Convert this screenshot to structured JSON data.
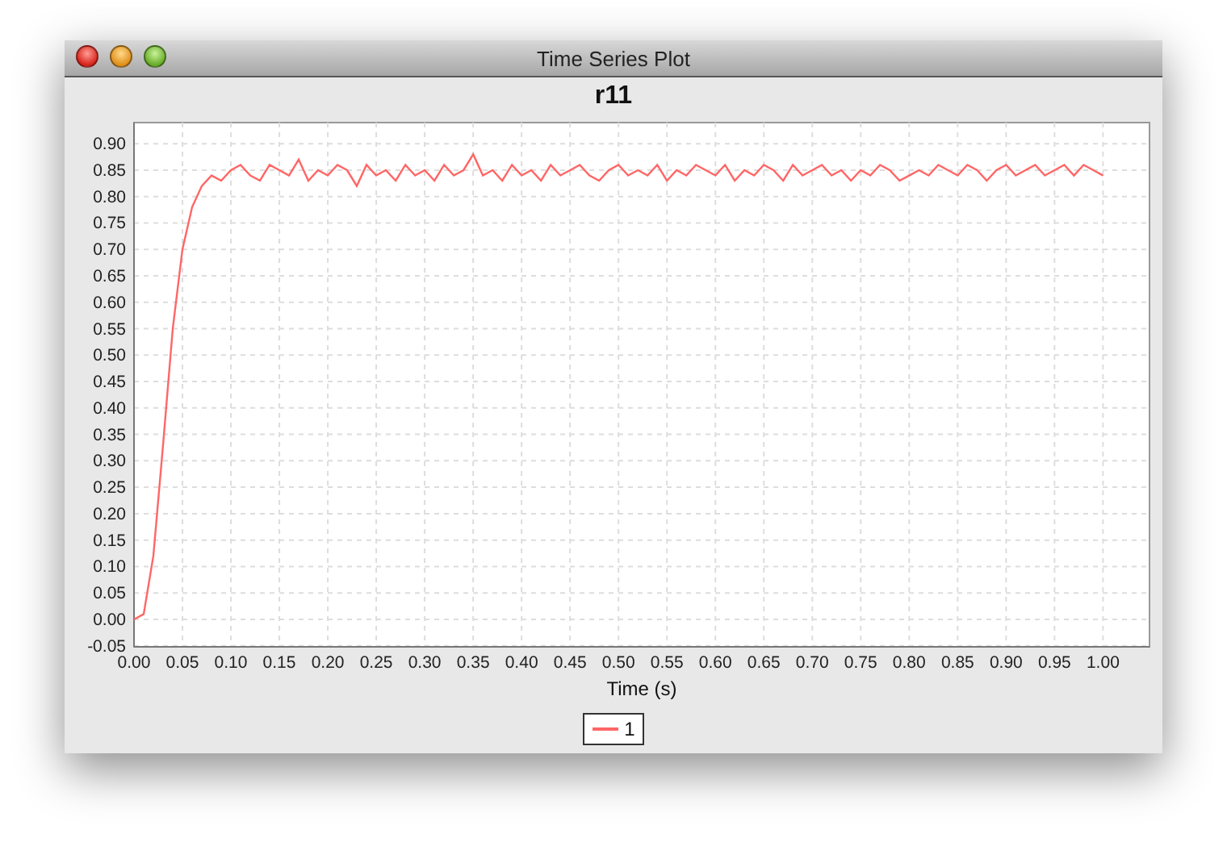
{
  "window": {
    "title": "Time Series Plot"
  },
  "chart": {
    "chart_data": {
      "type": "line",
      "grid": true,
      "title": "r11",
      "xlabel": "Time (s)",
      "x": [
        0,
        0.01,
        0.02,
        0.03,
        0.04,
        0.05,
        0.06,
        0.07,
        0.08,
        0.09,
        0.1,
        0.11,
        0.12,
        0.13,
        0.14,
        0.15,
        0.16,
        0.17,
        0.18,
        0.19,
        0.2,
        0.21,
        0.22,
        0.23,
        0.24,
        0.25,
        0.26,
        0.27,
        0.28,
        0.29,
        0.3,
        0.31,
        0.32,
        0.33,
        0.34,
        0.35,
        0.36,
        0.37,
        0.38,
        0.39,
        0.4,
        0.41,
        0.42,
        0.43,
        0.44,
        0.45,
        0.46,
        0.47,
        0.48,
        0.49,
        0.5,
        0.51,
        0.52,
        0.53,
        0.54,
        0.55,
        0.56,
        0.57,
        0.58,
        0.59,
        0.6,
        0.61,
        0.62,
        0.63,
        0.64,
        0.65,
        0.66,
        0.67,
        0.68,
        0.69,
        0.7,
        0.71,
        0.72,
        0.73,
        0.74,
        0.75,
        0.76,
        0.77,
        0.78,
        0.79,
        0.8,
        0.81,
        0.82,
        0.83,
        0.84,
        0.85,
        0.86,
        0.87,
        0.88,
        0.89,
        0.9,
        0.91,
        0.92,
        0.93,
        0.94,
        0.95,
        0.96,
        0.97,
        0.98,
        0.99,
        1
      ],
      "series": [
        {
          "name": "1",
          "color": "#ff6666",
          "values": [
            0,
            0.01,
            0.12,
            0.33,
            0.55,
            0.7,
            0.78,
            0.82,
            0.84,
            0.83,
            0.85,
            0.86,
            0.84,
            0.83,
            0.86,
            0.85,
            0.84,
            0.87,
            0.83,
            0.85,
            0.84,
            0.86,
            0.85,
            0.82,
            0.86,
            0.84,
            0.85,
            0.83,
            0.86,
            0.84,
            0.85,
            0.83,
            0.86,
            0.84,
            0.85,
            0.88,
            0.84,
            0.85,
            0.83,
            0.86,
            0.84,
            0.85,
            0.83,
            0.86,
            0.84,
            0.85,
            0.86,
            0.84,
            0.83,
            0.85,
            0.86,
            0.84,
            0.85,
            0.84,
            0.86,
            0.83,
            0.85,
            0.84,
            0.86,
            0.85,
            0.84,
            0.86,
            0.83,
            0.85,
            0.84,
            0.86,
            0.85,
            0.83,
            0.86,
            0.84,
            0.85,
            0.86,
            0.84,
            0.85,
            0.83,
            0.85,
            0.84,
            0.86,
            0.85,
            0.83,
            0.84,
            0.85,
            0.84,
            0.86,
            0.85,
            0.84,
            0.86,
            0.85,
            0.83,
            0.85,
            0.86,
            0.84,
            0.85,
            0.86,
            0.84,
            0.85,
            0.86,
            0.84,
            0.86,
            0.85,
            0.84
          ]
        }
      ],
      "xlim": [
        0,
        1.048
      ],
      "ylim": [
        -0.052,
        0.94
      ],
      "xticks": [
        {
          "value": 0,
          "label": "0.00"
        },
        {
          "value": 0.05,
          "label": "0.05"
        },
        {
          "value": 0.1,
          "label": "0.10"
        },
        {
          "value": 0.15,
          "label": "0.15"
        },
        {
          "value": 0.2,
          "label": "0.20"
        },
        {
          "value": 0.25,
          "label": "0.25"
        },
        {
          "value": 0.3,
          "label": "0.30"
        },
        {
          "value": 0.35,
          "label": "0.35"
        },
        {
          "value": 0.4,
          "label": "0.40"
        },
        {
          "value": 0.45,
          "label": "0.45"
        },
        {
          "value": 0.5,
          "label": "0.50"
        },
        {
          "value": 0.55,
          "label": "0.55"
        },
        {
          "value": 0.6,
          "label": "0.60"
        },
        {
          "value": 0.65,
          "label": "0.65"
        },
        {
          "value": 0.7,
          "label": "0.70"
        },
        {
          "value": 0.75,
          "label": "0.75"
        },
        {
          "value": 0.8,
          "label": "0.80"
        },
        {
          "value": 0.85,
          "label": "0.85"
        },
        {
          "value": 0.9,
          "label": "0.90"
        },
        {
          "value": 0.95,
          "label": "0.95"
        },
        {
          "value": 1,
          "label": "1.00"
        }
      ],
      "yticks": [
        {
          "value": -0.05,
          "label": "-0.05"
        },
        {
          "value": 0,
          "label": "0.00"
        },
        {
          "value": 0.05,
          "label": "0.05"
        },
        {
          "value": 0.1,
          "label": "0.10"
        },
        {
          "value": 0.15,
          "label": "0.15"
        },
        {
          "value": 0.2,
          "label": "0.20"
        },
        {
          "value": 0.25,
          "label": "0.25"
        },
        {
          "value": 0.3,
          "label": "0.30"
        },
        {
          "value": 0.35,
          "label": "0.35"
        },
        {
          "value": 0.4,
          "label": "0.40"
        },
        {
          "value": 0.45,
          "label": "0.45"
        },
        {
          "value": 0.5,
          "label": "0.50"
        },
        {
          "value": 0.55,
          "label": "0.55"
        },
        {
          "value": 0.6,
          "label": "0.60"
        },
        {
          "value": 0.65,
          "label": "0.65"
        },
        {
          "value": 0.7,
          "label": "0.70"
        },
        {
          "value": 0.75,
          "label": "0.75"
        },
        {
          "value": 0.8,
          "label": "0.80"
        },
        {
          "value": 0.85,
          "label": "0.85"
        },
        {
          "value": 0.9,
          "label": "0.90"
        }
      ]
    }
  }
}
